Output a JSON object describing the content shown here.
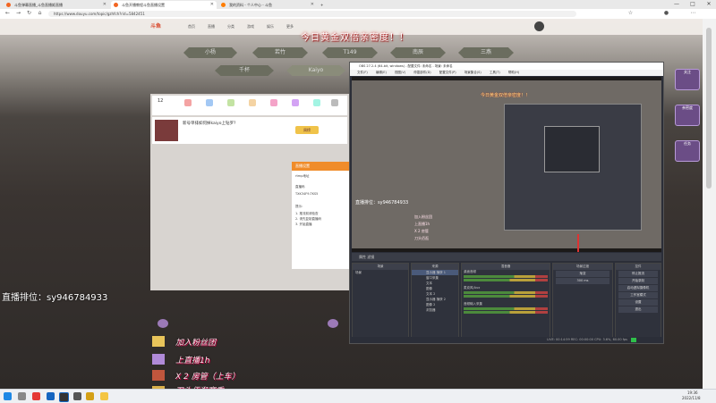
{
  "browser": {
    "tabs": [
      {
        "label": "斗鱼弹幕直播_斗鱼直播姬直播",
        "active": false,
        "color": "#f26522"
      },
      {
        "label": "斗鱼开播教程斗鱼直播设置",
        "active": true,
        "color": "#f26522"
      },
      {
        "label": "我的资料 - 个人中心 - 斗鱼",
        "active": false,
        "color": "#ff7d00"
      }
    ],
    "url": "https://www.douyu.com/topic/gzhfch?rid=5842451",
    "window_controls": [
      "—",
      "□",
      "✕"
    ]
  },
  "site": {
    "logo": "斗鱼",
    "nav": [
      "首页",
      "直播",
      "分类",
      "游戏",
      "娱乐",
      "更多"
    ],
    "banner": "今日黄金双倍亲密度！！",
    "pills": [
      "小杨",
      "若竹",
      "T149",
      "南辰",
      "三燕",
      "千杯",
      "Kaiyo"
    ]
  },
  "room": {
    "follow_count": "12",
    "title": "新号单排如何掉kaiyo上钻罗?",
    "rank_badge": "周榜",
    "dialog": {
      "title": "直播设置",
      "lines": [
        "rtmp地址",
        "直播码",
        "TXK34F9-TKS5",
        "提示：",
        "1. 推流前请检查",
        "2. 请先复制直播码",
        "3. 开始直播"
      ]
    }
  },
  "overlay": {
    "rank_id": "直播排位：sy946784933",
    "danmaku": [
      "加入粉丝团",
      "上直播1h",
      "X 2 房管（上车）",
      "刀头佰逛赛季"
    ]
  },
  "obs": {
    "title": "OBS 27.2.4 (64-bit, windows) - 配置文件: 未命名 - 场景: 未命名",
    "menu": [
      "文件(F)",
      "编辑(E)",
      "视图(V)",
      "停靠部件(D)",
      "配置文件(P)",
      "场景集合(S)",
      "工具(T)",
      "帮助(H)"
    ],
    "preview_banner": "今日黄金双倍亲密度！！",
    "preview_rank": "直播排位：sy946784933",
    "preview_danmaku": [
      "加入粉丝团",
      "上直播1h",
      "X 2 房管",
      "刀头佰逛"
    ],
    "control_bar": "属性    滤镜",
    "docks": {
      "scenes": {
        "header": "场景",
        "items": [
          "场景"
        ]
      },
      "sources": {
        "header": "来源",
        "items": [
          "显示器 捕获 1",
          "窗口采集",
          "文本",
          "图像",
          "文本 2",
          "显示器 捕获 2",
          "图像 2",
          "浏览器"
        ]
      },
      "mixer": {
        "header": "混音器",
        "channels": [
          "桌面音频",
          "麦克风/Aux",
          "音频输入采集"
        ]
      },
      "transitions": {
        "header": "场景过渡",
        "type": "渐变",
        "duration": "300 ms"
      },
      "controls": {
        "header": "控件",
        "buttons": [
          "停止推流",
          "开始录制",
          "启动虚拟摄像机",
          "工作室模式",
          "设置",
          "退出"
        ]
      }
    },
    "status": "LIVE: 00:14:59   REC: 00:00:00   CPU: 3.6%, 60.00 fps"
  },
  "sidebar": {
    "items": [
      "关注",
      "亲密度",
      "任务"
    ]
  },
  "taskbar": {
    "time": "19:36",
    "date": "2022/11/8"
  }
}
